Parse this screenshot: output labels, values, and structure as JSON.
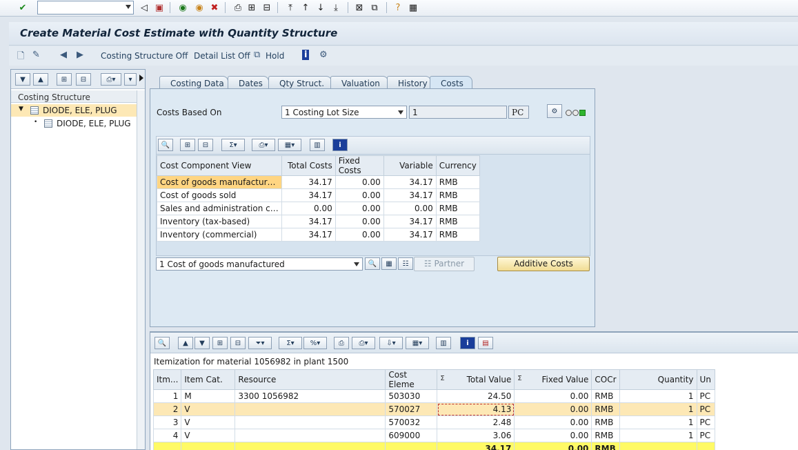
{
  "window": {
    "title": "Create Material Cost Estimate with Quantity Structure"
  },
  "app_toolbar": {
    "costing_structure_off": "Costing Structure Off",
    "detail_list_off": "Detail List Off",
    "hold": "Hold"
  },
  "left_panel": {
    "header": "Costing Structure",
    "items": [
      {
        "label": "DIODE, ELE, PLUG"
      },
      {
        "label": "DIODE, ELE, PLUG"
      }
    ]
  },
  "tabs": [
    "Costing Data",
    "Dates",
    "Qty Struct.",
    "Valuation",
    "History",
    "Costs"
  ],
  "costs_based_on": {
    "label": "Costs Based On",
    "selected": "1 Costing Lot Size",
    "quantity": "1",
    "unit": "PC"
  },
  "cost_grid": {
    "headers": [
      "Cost Component View",
      "Total Costs",
      "Fixed Costs",
      "Variable",
      "Currency"
    ],
    "rows": [
      [
        "Cost of goods manufactur…",
        "34.17",
        "0.00",
        "34.17",
        "RMB"
      ],
      [
        "Cost of goods sold",
        "34.17",
        "0.00",
        "34.17",
        "RMB"
      ],
      [
        "Sales and administration c…",
        "0.00",
        "0.00",
        "0.00",
        "RMB"
      ],
      [
        "Inventory (tax-based)",
        "34.17",
        "0.00",
        "34.17",
        "RMB"
      ],
      [
        "Inventory (commercial)",
        "34.17",
        "0.00",
        "34.17",
        "RMB"
      ]
    ]
  },
  "view_select": {
    "selected": "1 Cost of goods manufactured",
    "partner": "Partner",
    "additive_costs": "Additive Costs"
  },
  "itemization": {
    "caption": "Itemization for material 1056982 in plant 1500",
    "headers": [
      "Itm...",
      "Item Cat.",
      "Resource",
      "Cost Eleme",
      "Total Value",
      "Fixed Value",
      "COCr",
      "Quantity",
      "Un"
    ],
    "rows": [
      [
        "1",
        "M",
        "3300 1056982",
        "503030",
        "24.50",
        "0.00",
        "RMB",
        "1",
        "PC"
      ],
      [
        "2",
        "V",
        "",
        "570027",
        "4.13",
        "0.00",
        "RMB",
        "1",
        "PC"
      ],
      [
        "3",
        "V",
        "",
        "570032",
        "2.48",
        "0.00",
        "RMB",
        "1",
        "PC"
      ],
      [
        "4",
        "V",
        "",
        "609000",
        "3.06",
        "0.00",
        "RMB",
        "1",
        "PC"
      ]
    ],
    "total": {
      "total_value": "34.17",
      "fixed_value": "0.00",
      "currency": "RMB"
    }
  },
  "colors": {
    "selection": "#fde8b5",
    "total_row": "#fffa66",
    "light_green": "#2fb52f"
  }
}
